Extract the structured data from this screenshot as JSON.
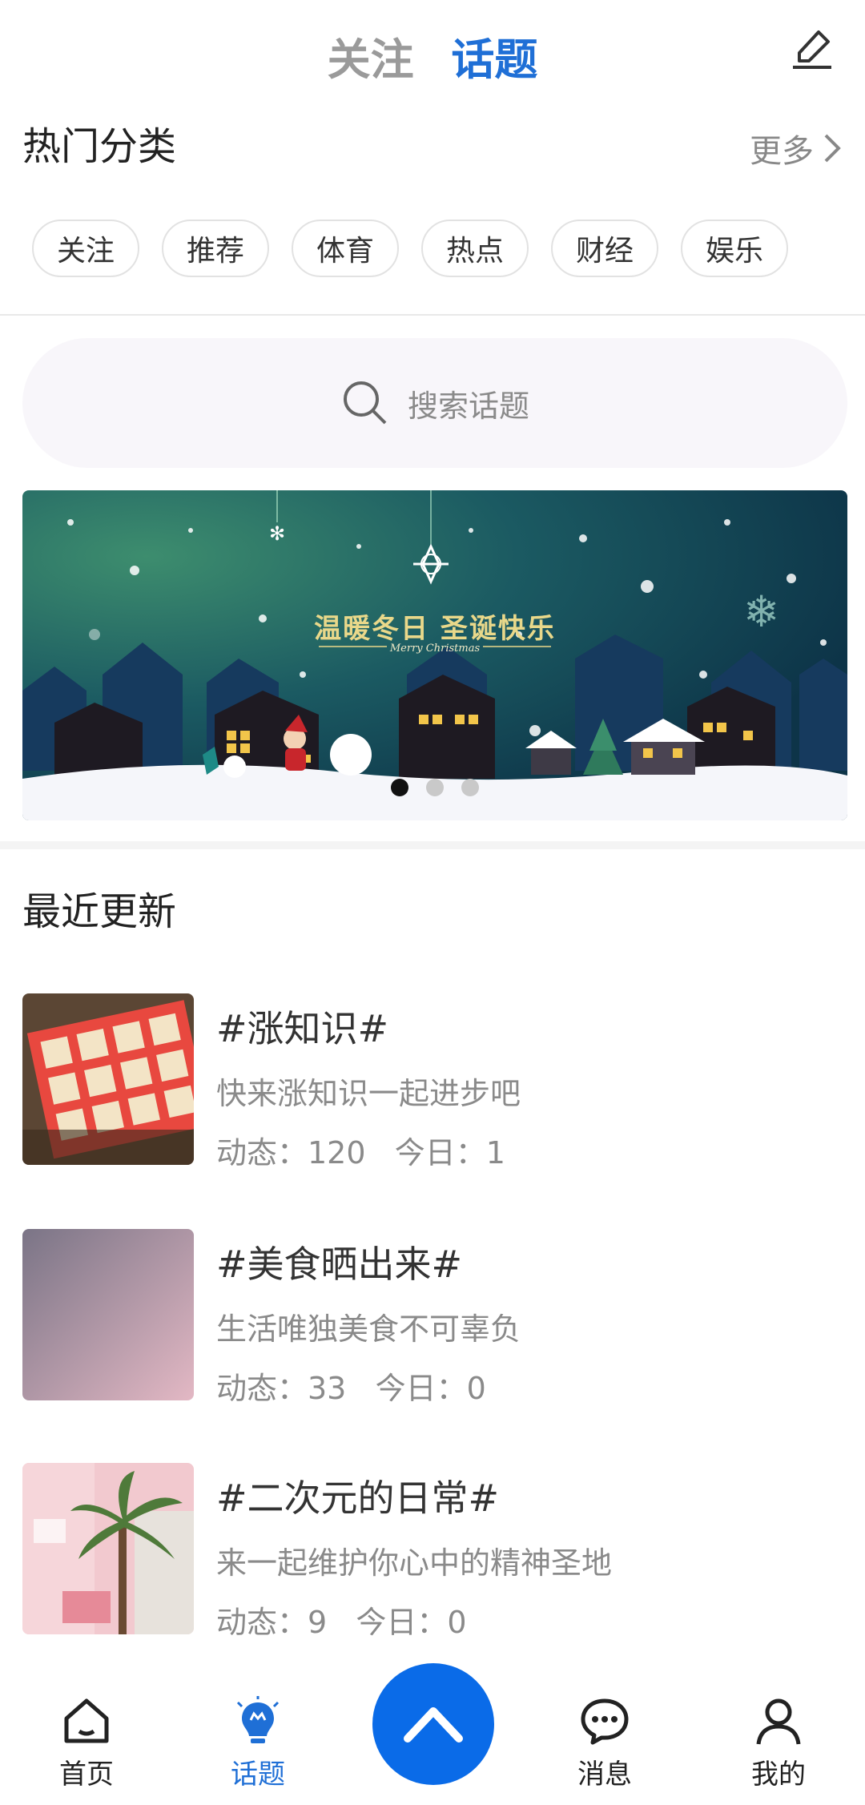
{
  "header": {
    "tabs": [
      {
        "label": "关注",
        "active": false
      },
      {
        "label": "话题",
        "active": true
      }
    ],
    "edit_icon": "edit-icon",
    "active_color": "#1f6fd6",
    "inactive_color": "#9a9a9a"
  },
  "hot": {
    "title": "热门分类",
    "more_label": "更多",
    "chips": [
      "关注",
      "推荐",
      "体育",
      "热点",
      "财经",
      "娱乐"
    ]
  },
  "search": {
    "placeholder": "搜索话题",
    "icon": "search-icon"
  },
  "banner": {
    "headline": "温暖冬日  圣诞快乐",
    "subline": "Merry Christmas",
    "slides_total": 3,
    "active_slide": 1
  },
  "recent": {
    "title": "最近更新",
    "items": [
      {
        "title": "#涨知识#",
        "desc": "快来涨知识一起进步吧",
        "stats": "动态：120   今日：1"
      },
      {
        "title": "#美食晒出来#",
        "desc": "生活唯独美食不可辜负",
        "stats": "动态：33   今日：0"
      },
      {
        "title": "#二次元的日常#",
        "desc": "来一起维护你心中的精神圣地",
        "stats": "动态：9   今日：0"
      }
    ]
  },
  "bottom_nav": {
    "items": [
      {
        "label": "首页",
        "icon": "home-icon",
        "active": false
      },
      {
        "label": "话题",
        "icon": "bulb-icon",
        "active": true
      },
      {
        "label": "消息",
        "icon": "message-icon",
        "active": false
      },
      {
        "label": "我的",
        "icon": "user-icon",
        "active": false
      }
    ],
    "fab_icon": "chevron-up-icon",
    "fab_color": "#0a6be8"
  }
}
